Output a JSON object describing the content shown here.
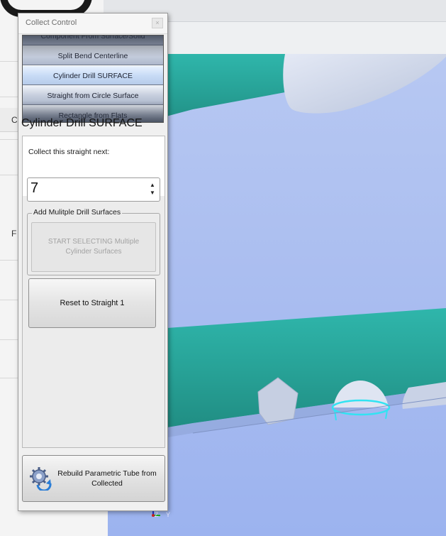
{
  "window": {
    "title": "Collect Control",
    "close_label": "×"
  },
  "methods": {
    "items": [
      {
        "label": "Component From Surface/Solid"
      },
      {
        "label": "Split Bend Centerline"
      },
      {
        "label": "Cylinder Drill SURFACE"
      },
      {
        "label": "Straight from Circle Surface"
      },
      {
        "label": "Rectangle from Flats"
      }
    ],
    "selected_index": 2
  },
  "heading": "Cylinder Drill SURFACE",
  "collect_next": {
    "label": "Collect this straight next:",
    "value": "7"
  },
  "drill_group": {
    "legend": "Add Mulitple Drill Surfaces",
    "start_button": "START SELECTING Multiple Cylinder Surfaces"
  },
  "reset_button": "Reset to Straight 1",
  "rebuild_button": "Rebuild Parametric Tube from Collected",
  "background": {
    "left_tab_1": "Co",
    "left_tab_2": "F"
  },
  "axis": {
    "z_label": "Z",
    "y_label": "Y"
  },
  "colors": {
    "viewport": "#abbef0",
    "tube": "#2aa79c",
    "highlight": "#31e3f2"
  }
}
